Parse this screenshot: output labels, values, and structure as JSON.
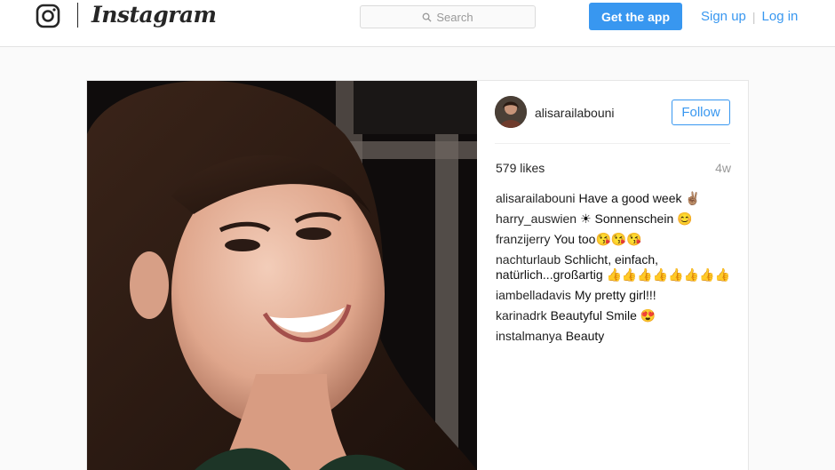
{
  "header": {
    "wordmark": "Instagram",
    "search": {
      "placeholder": "Search",
      "icon": "search-icon"
    },
    "get_app_label": "Get the app",
    "signup_label": "Sign up",
    "separator": "|",
    "login_label": "Log in"
  },
  "post": {
    "username": "alisarailabouni",
    "follow_label": "Follow",
    "likes": "579 likes",
    "age": "4w",
    "comments": [
      {
        "user": "alisarailabouni",
        "text": "Have a good week ✌🏽"
      },
      {
        "user": "harry_auswien",
        "text": "☀ Sonnenschein 😊"
      },
      {
        "user": "franzijerry",
        "text": "You too😘😘😘"
      },
      {
        "user": "nachturlaub",
        "text": "Schlicht, einfach, natürlich...großartig 👍👍👍👍👍👍👍👍"
      },
      {
        "user": "iambelladavis",
        "text": "My pretty girl!!!"
      },
      {
        "user": "karinadrk",
        "text": "Beautyful Smile 😍"
      },
      {
        "user": "instalmanya",
        "text": "Beauty"
      }
    ]
  },
  "colors": {
    "accent": "#3897f0",
    "text": "#262626",
    "muted": "#999999",
    "background": "#fafafa"
  }
}
